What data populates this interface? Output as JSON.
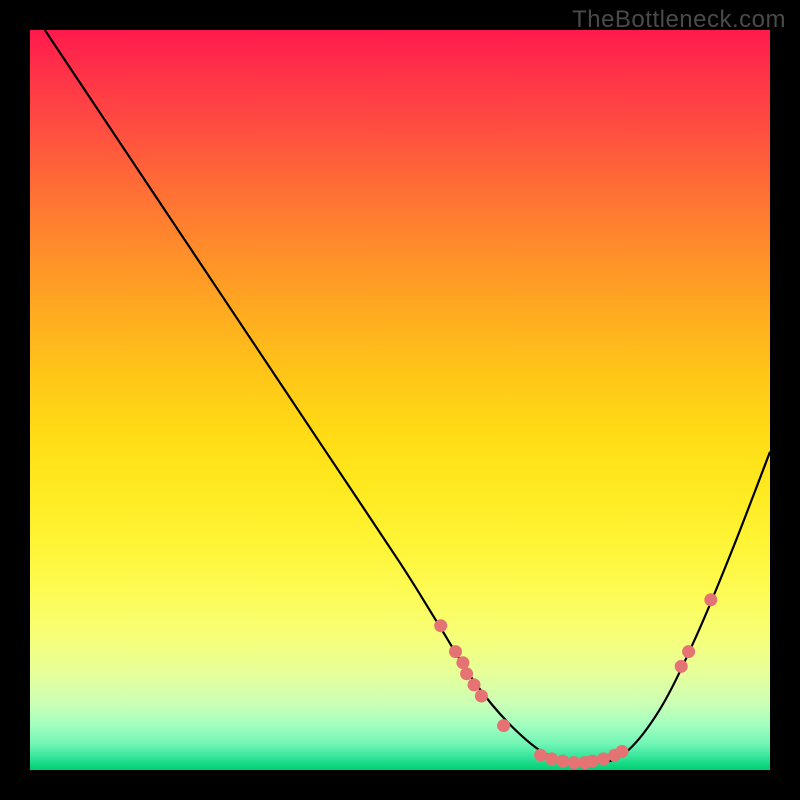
{
  "watermark": "TheBottleneck.com",
  "chart_data": {
    "type": "line",
    "title": "",
    "xlabel": "",
    "ylabel": "",
    "ylim": [
      0,
      100
    ],
    "xlim": [
      0,
      100
    ],
    "series": [
      {
        "name": "curve",
        "x": [
          2,
          10,
          20,
          30,
          40,
          50,
          55,
          60,
          65,
          70,
          75,
          80,
          85,
          90,
          95,
          100
        ],
        "y": [
          100,
          88,
          73,
          58,
          43,
          28,
          20,
          12,
          6,
          2,
          1,
          2,
          8,
          18,
          30,
          43
        ]
      }
    ],
    "markers": [
      {
        "x": 55.5,
        "y": 19.5
      },
      {
        "x": 57.5,
        "y": 16
      },
      {
        "x": 58.5,
        "y": 14.5
      },
      {
        "x": 59,
        "y": 13
      },
      {
        "x": 60,
        "y": 11.5
      },
      {
        "x": 61,
        "y": 10
      },
      {
        "x": 64,
        "y": 6
      },
      {
        "x": 69,
        "y": 2
      },
      {
        "x": 70.5,
        "y": 1.5
      },
      {
        "x": 72,
        "y": 1.2
      },
      {
        "x": 73.5,
        "y": 1
      },
      {
        "x": 75,
        "y": 1
      },
      {
        "x": 76,
        "y": 1.2
      },
      {
        "x": 77.5,
        "y": 1.5
      },
      {
        "x": 79,
        "y": 2
      },
      {
        "x": 80,
        "y": 2.5
      },
      {
        "x": 88,
        "y": 14
      },
      {
        "x": 89,
        "y": 16
      },
      {
        "x": 92,
        "y": 23
      }
    ],
    "marker_color": "#e57373"
  }
}
